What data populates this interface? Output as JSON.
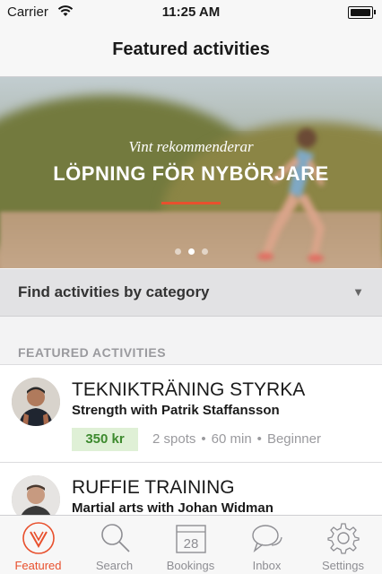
{
  "status_bar": {
    "carrier": "Carrier",
    "time": "11:25 AM"
  },
  "nav": {
    "title": "Featured activities"
  },
  "hero": {
    "subtitle": "Vint rekommenderar",
    "title": "LÖPNING FÖR NYBÖRJARE",
    "page_count": 3,
    "active_page": 2
  },
  "category": {
    "label": "Find activities by category"
  },
  "section": {
    "header": "FEATURED ACTIVITIES"
  },
  "activities": [
    {
      "title": "TEKNIKTRÄNING STYRKA",
      "subtitle": "Strength with Patrik Staffansson",
      "price": "350 kr",
      "spots": "2 spots",
      "duration": "60 min",
      "level": "Beginner"
    },
    {
      "title": "RUFFIE TRAINING",
      "subtitle": "Martial arts with Johan Widman"
    }
  ],
  "tabs": [
    {
      "label": "Featured",
      "icon": "vint-logo-icon",
      "active": true
    },
    {
      "label": "Search",
      "icon": "search-icon",
      "active": false
    },
    {
      "label": "Bookings",
      "icon": "calendar-icon",
      "badge": "28",
      "active": false
    },
    {
      "label": "Inbox",
      "icon": "chat-bubbles-icon",
      "active": false
    },
    {
      "label": "Settings",
      "icon": "gear-icon",
      "active": false
    }
  ],
  "colors": {
    "accent": "#e8502d",
    "price_bg": "#dff0d6",
    "price_text": "#3d8a2e"
  }
}
